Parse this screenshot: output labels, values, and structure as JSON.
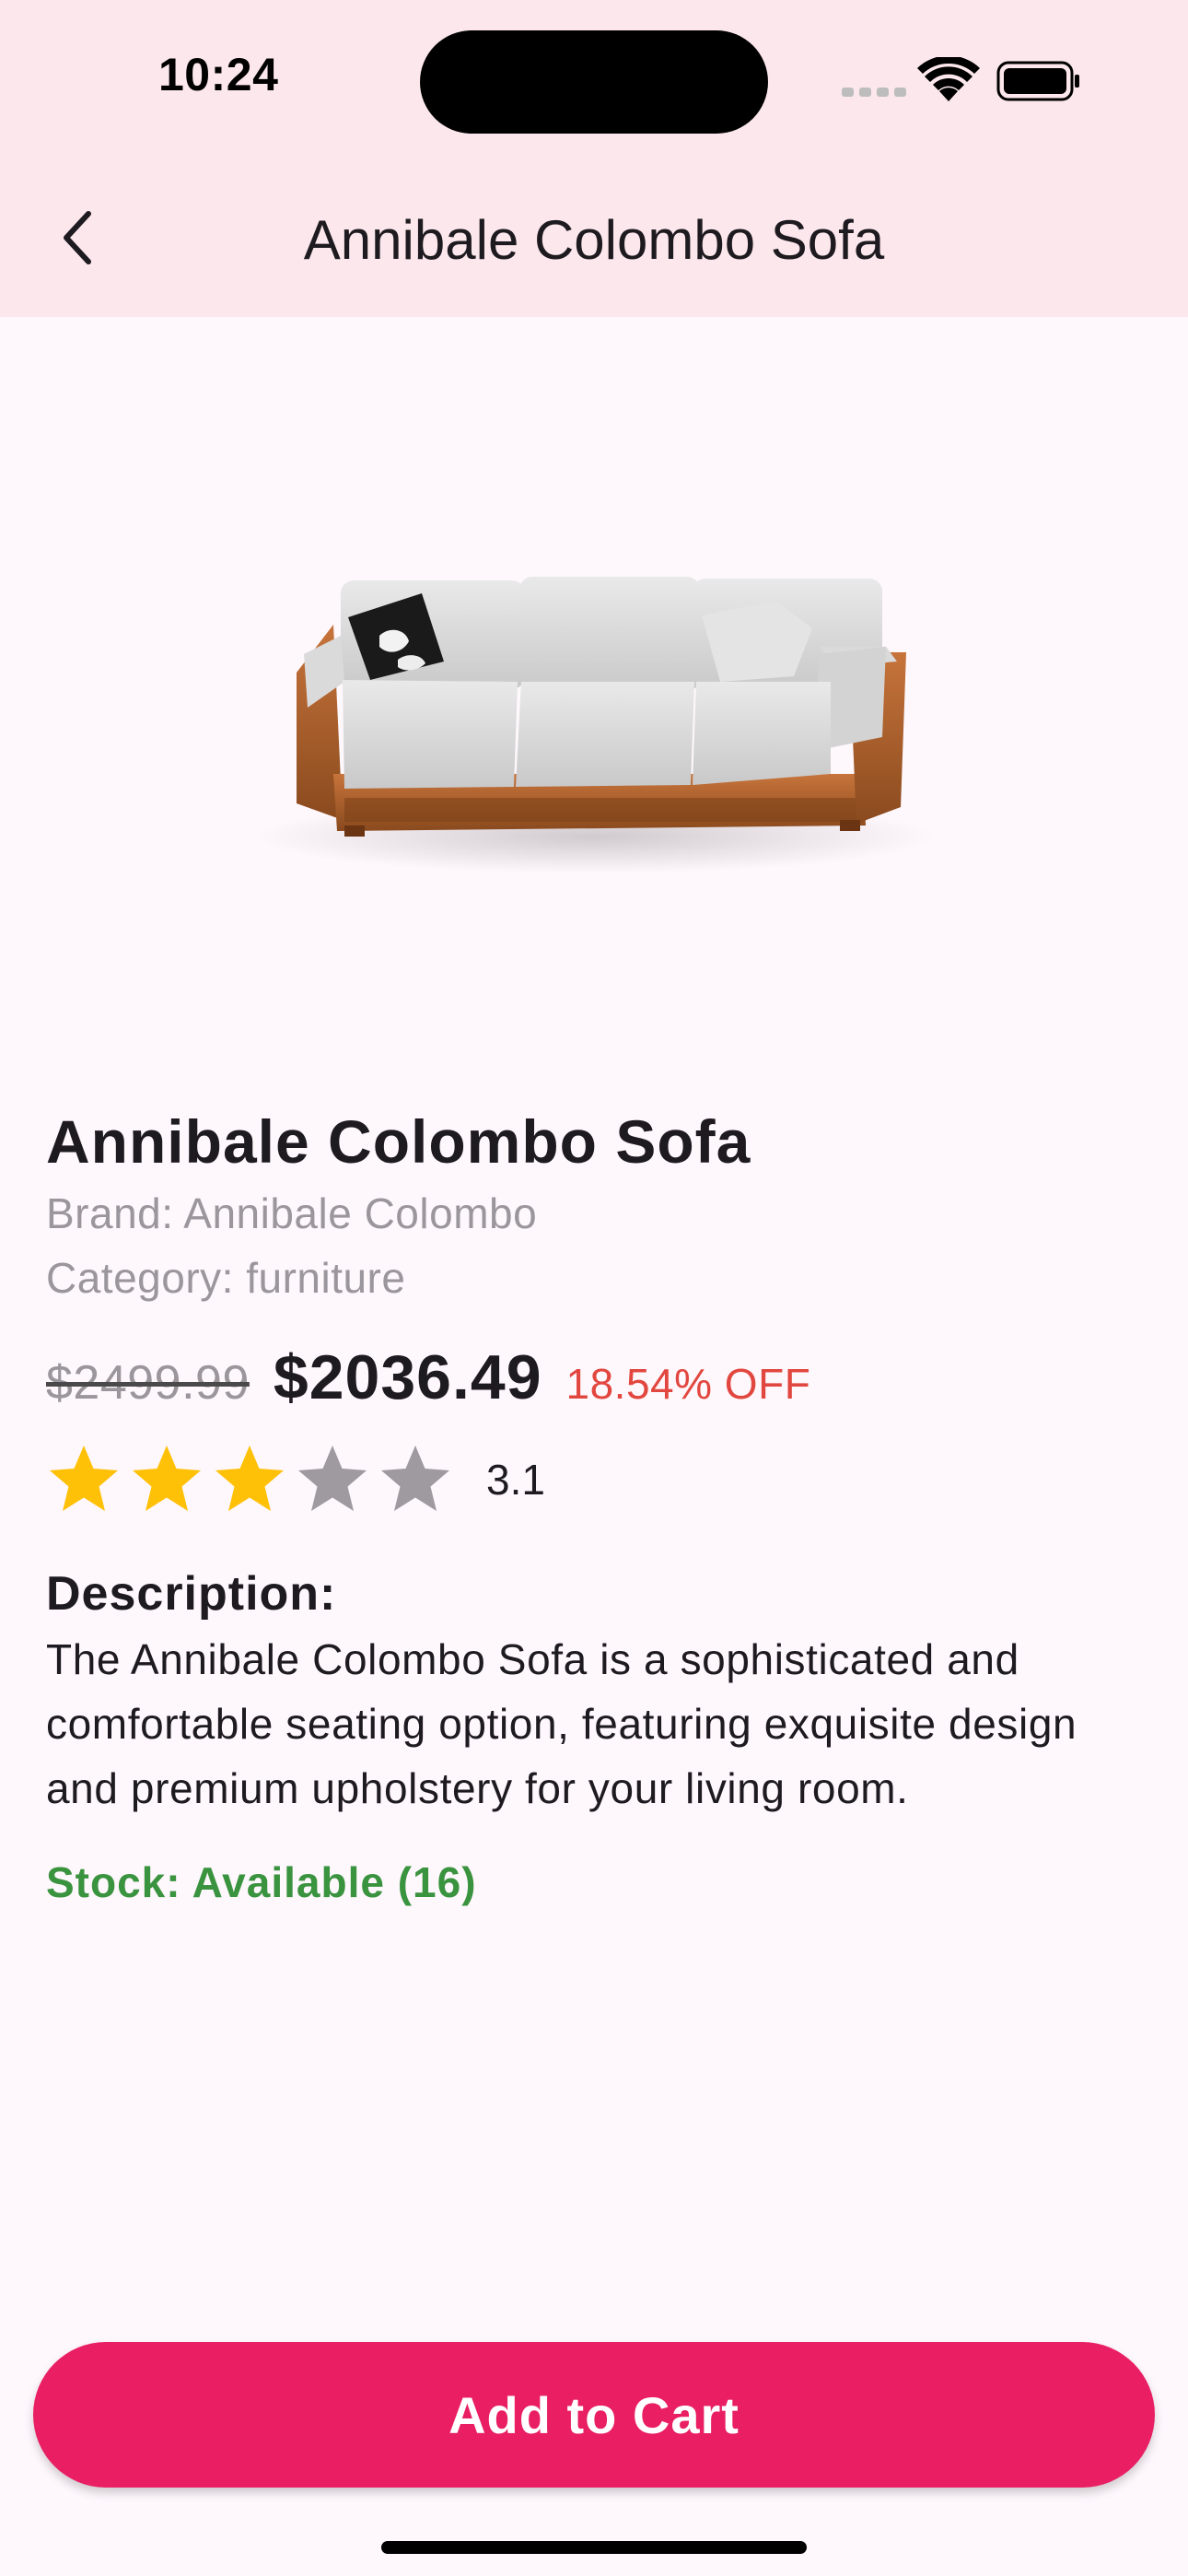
{
  "status_bar": {
    "time": "10:24"
  },
  "app_bar": {
    "title": "Annibale Colombo Sofa",
    "back_icon": "chevron-left-icon"
  },
  "product": {
    "title": "Annibale Colombo Sofa",
    "brand": "Brand: Annibale Colombo",
    "category": "Category: furniture",
    "original_price": "$2499.99",
    "price": "$2036.49",
    "discount": "18.54% OFF",
    "rating": 3.1,
    "rating_label": "3.1",
    "stars_max": 5,
    "description_heading": "Description:",
    "description": "The Annibale Colombo Sofa is a sophisticated and comfortable seating option, featuring exquisite design and premium upholstery for your living room.",
    "stock": "Stock: Available (16)"
  },
  "actions": {
    "add_to_cart": "Add to Cart"
  },
  "colors": {
    "app_bar_bg": "#FCE7EC",
    "page_bg": "#FEF7FC",
    "accent": "#E91E63",
    "discount": "#E2473F",
    "stock": "#3A933E",
    "star_filled": "#FFC107",
    "star_empty": "#9E9A9F"
  }
}
